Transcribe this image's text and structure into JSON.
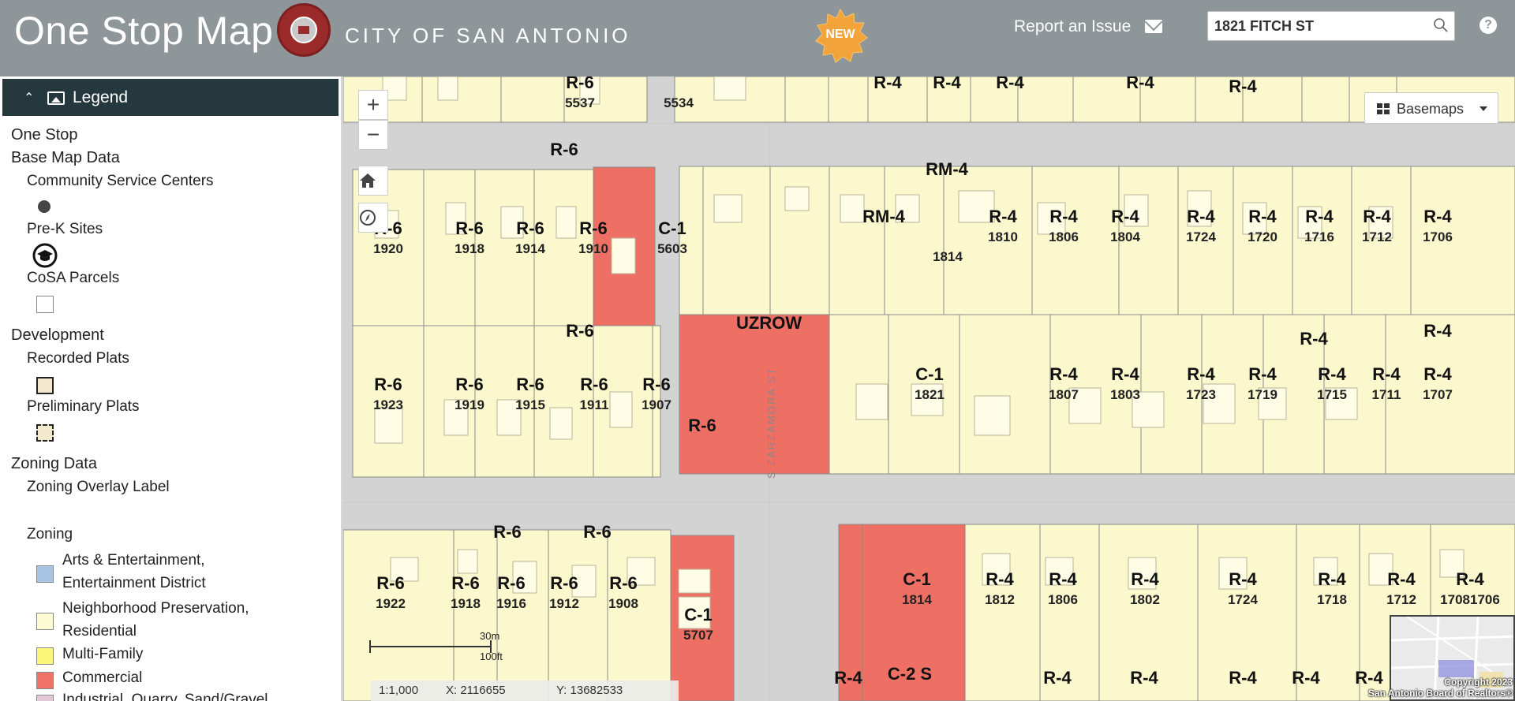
{
  "header": {
    "app_title": "One Stop Map",
    "city_name": "CITY OF SAN ANTONIO",
    "new_badge": "NEW",
    "report_label": "Report an Issue",
    "search_value": "1821 FITCH ST",
    "help": "?"
  },
  "legend": {
    "title": "Legend",
    "one_stop": "One Stop",
    "base_map_data": "Base Map Data",
    "community_service_centers": "Community Service Centers",
    "prek_sites": "Pre-K Sites",
    "cosa_parcels": "CoSA Parcels",
    "development": "Development",
    "recorded_plats": "Recorded Plats",
    "preliminary_plats": "Preliminary Plats",
    "zoning_data": "Zoning Data",
    "zoning_overlay_label": "Zoning Overlay Label",
    "zoning": "Zoning",
    "zoning_items": [
      {
        "label1": "Arts & Entertainment,",
        "label2": "Entertainment District",
        "color": "#a7c4e2"
      },
      {
        "label1": "Neighborhood Preservation,",
        "label2": "Residential",
        "color": "#fdfbd2"
      },
      {
        "label1": "Multi-Family",
        "label2": "",
        "color": "#fbf67a"
      },
      {
        "label1": "Commercial",
        "label2": "",
        "color": "#ef7266"
      },
      {
        "label1": "Industrial, Quarry, Sand/Gravel",
        "label2": "",
        "color": "#e3c8d8"
      }
    ]
  },
  "map": {
    "zoom_in": "+",
    "zoom_out": "−",
    "basemaps_label": "Basemaps",
    "street_label": "S ZARZAMORA ST",
    "street_label_2": "UZROW",
    "scale_m": "30m",
    "scale_ft": "100ft",
    "scale_ratio": "1:1,000",
    "coord_x": "X: 2116655",
    "coord_y": "Y: 13682533",
    "copyright_1": "Copyright 2023",
    "copyright_2": "San Antonio Board of Realtors®",
    "colors": {
      "residential": "#fbf8cd",
      "commercial": "#ee7065",
      "street": "#d3d3d3",
      "building": "#fffde6",
      "parcel_line": "#8a8a8a"
    },
    "labels": [
      {
        "t": "R-6",
        "n": "1920"
      },
      {
        "t": "R-6",
        "n": "1918"
      },
      {
        "t": "R-6",
        "n": "1914"
      },
      {
        "t": "R-6",
        "n": "1910"
      },
      {
        "t": "C-1",
        "n": "5603"
      },
      {
        "t": "R-6",
        "n": "1923"
      },
      {
        "t": "R-6",
        "n": "1919"
      },
      {
        "t": "R-6",
        "n": "1915"
      },
      {
        "t": "R-6",
        "n": "1911"
      },
      {
        "t": "R-6",
        "n": "1907"
      },
      {
        "t": "R-6",
        "n": ""
      },
      {
        "t": "RM-4",
        "n": ""
      },
      {
        "t": "RM-4",
        "n": ""
      },
      {
        "t": "",
        "n": "1814"
      },
      {
        "t": "R-4",
        "n": "1810"
      },
      {
        "t": "R-4",
        "n": "1806"
      },
      {
        "t": "R-4",
        "n": "1804"
      },
      {
        "t": "R-4",
        "n": "1724"
      },
      {
        "t": "R-4",
        "n": "1720"
      },
      {
        "t": "R-4",
        "n": "1716"
      },
      {
        "t": "R-4",
        "n": "1712"
      },
      {
        "t": "R-4",
        "n": "1706"
      },
      {
        "t": "C-1",
        "n": "1821"
      },
      {
        "t": "R-4",
        "n": "1807"
      },
      {
        "t": "R-4",
        "n": "1803"
      },
      {
        "t": "R-4",
        "n": "1723"
      },
      {
        "t": "R-4",
        "n": "1719"
      },
      {
        "t": "R-4",
        "n": "1715"
      },
      {
        "t": "R-4",
        "n": "1711"
      },
      {
        "t": "R-4",
        "n": "1707"
      },
      {
        "t": "R-6",
        "n": "1922"
      },
      {
        "t": "R-6",
        "n": "1918"
      },
      {
        "t": "R-6",
        "n": "1916"
      },
      {
        "t": "R-6",
        "n": "1912"
      },
      {
        "t": "R-6",
        "n": "1908"
      },
      {
        "t": "C-1",
        "n": "5707"
      },
      {
        "t": "C-1",
        "n": "1814"
      },
      {
        "t": "R-4",
        "n": "1812"
      },
      {
        "t": "R-4",
        "n": "1806"
      },
      {
        "t": "R-4",
        "n": "1802"
      },
      {
        "t": "R-4",
        "n": "1724"
      },
      {
        "t": "R-4",
        "n": "1718"
      },
      {
        "t": "R-4",
        "n": "1712"
      },
      {
        "t": "R-4",
        "n": "17081706"
      },
      {
        "t": "C-2 S",
        "n": ""
      },
      {
        "t": "R-6",
        "n": "5537"
      },
      {
        "t": "",
        "n": "5534"
      }
    ]
  }
}
